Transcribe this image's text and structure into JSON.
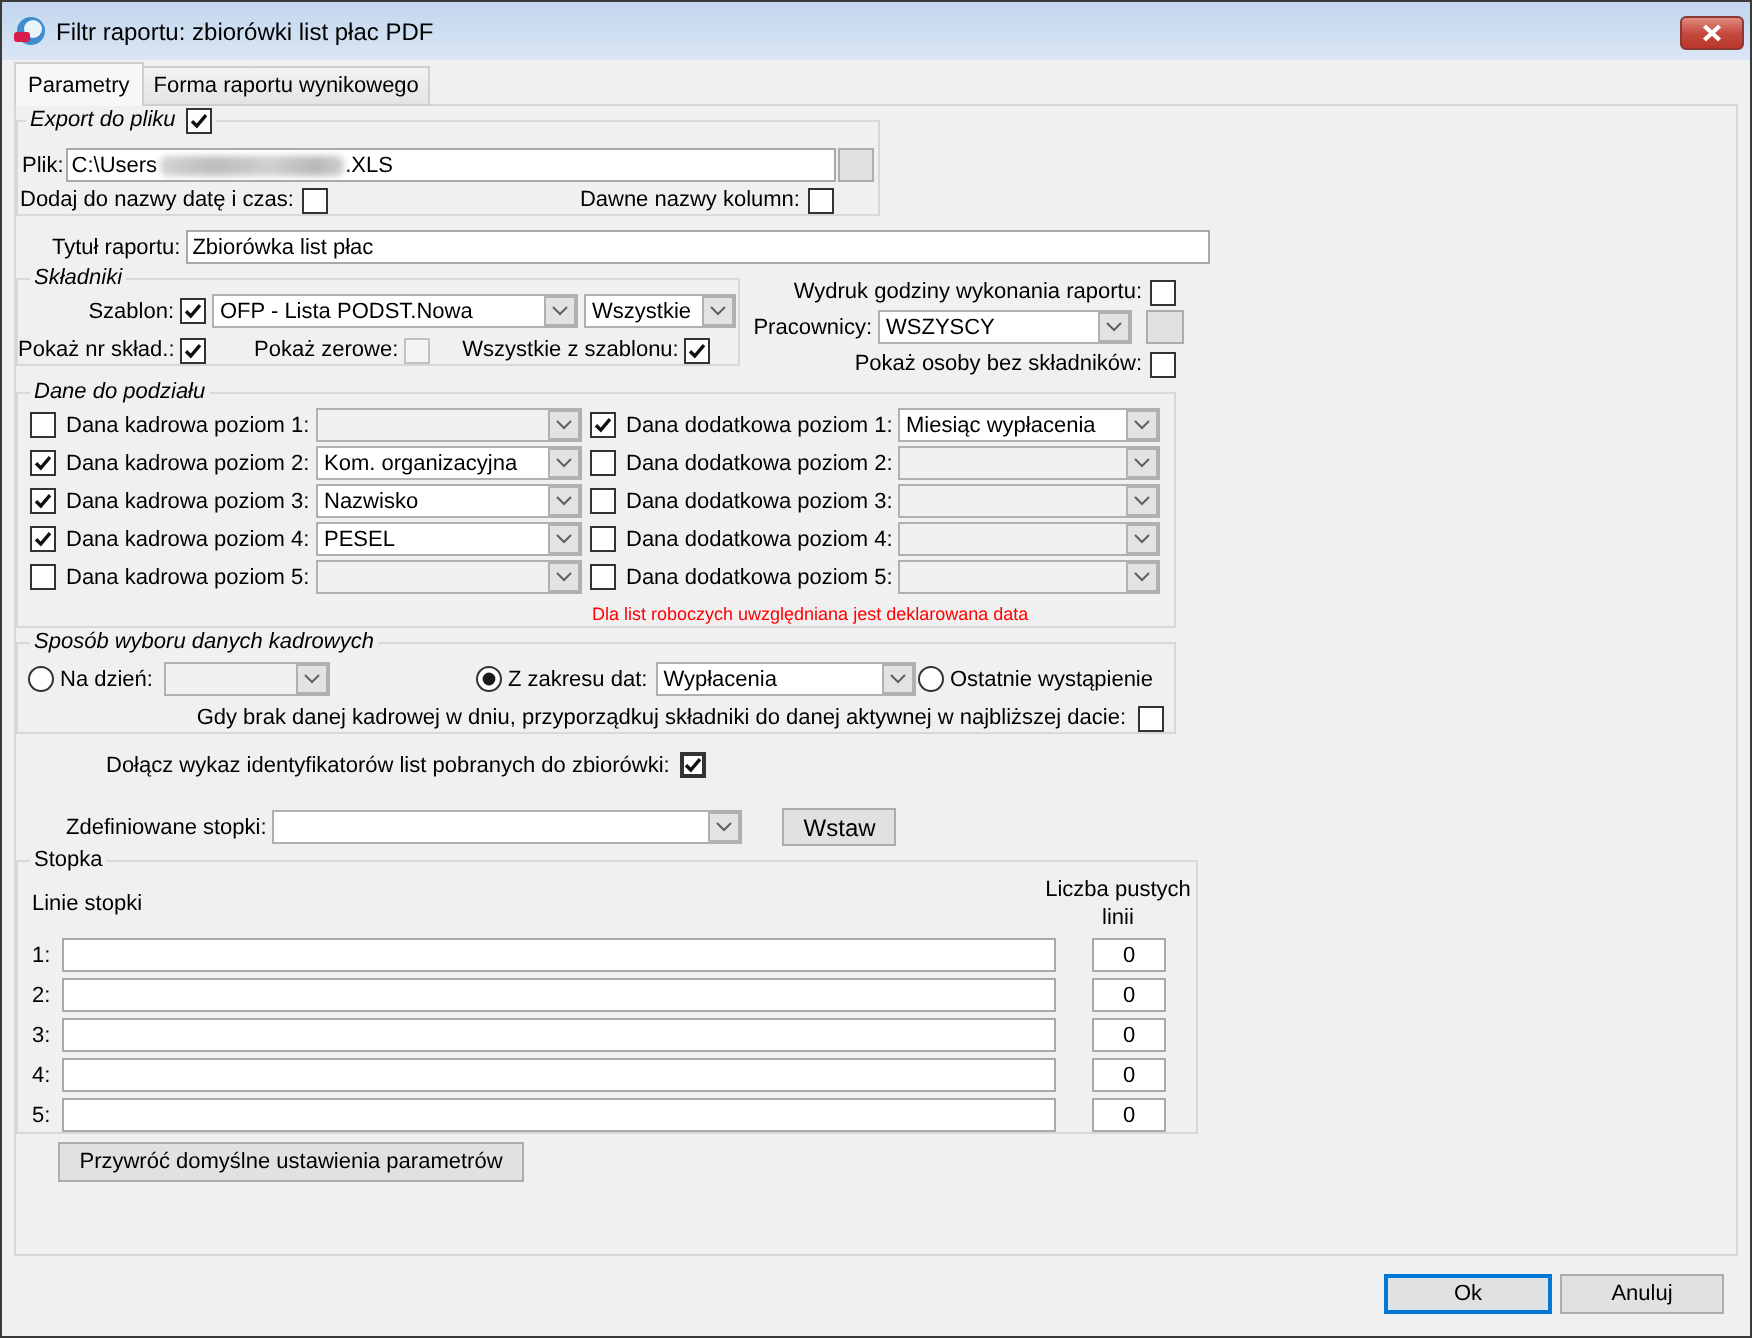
{
  "window": {
    "title": "Filtr raportu: zbiorówki list płac PDF"
  },
  "tabs": [
    {
      "label": "Parametry",
      "selected": true
    },
    {
      "label": "Forma raportu wynikowego",
      "selected": false
    }
  ],
  "export": {
    "legend": "Export do pliku",
    "checked": true,
    "file": {
      "label": "Plik:",
      "value_start": "C:\\Users",
      "value_blurred": true,
      "value_end": ".XLS"
    },
    "add_date_time": {
      "label": "Dodaj do nazwy datę i czas:",
      "checked": false
    },
    "old_column_names": {
      "label": "Dawne nazwy kolumn:",
      "checked": false
    }
  },
  "report_title": {
    "label": "Tytuł raportu:",
    "value": "Zbiorówka list płac"
  },
  "components": {
    "legend": "Składniki",
    "template": {
      "label": "Szablon:",
      "checked": true,
      "value": "OFP - Lista PODST.Nowa",
      "scope": "Wszystkie"
    },
    "show_number": {
      "label": "Pokaż nr skład.:",
      "checked": true
    },
    "show_zero": {
      "label": "Pokaż zerowe:",
      "checked": false,
      "disabled": true
    },
    "all_from_template": {
      "label": "Wszystkie z szablonu:",
      "checked": true
    }
  },
  "print_time": {
    "label": "Wydruk godziny wykonania raportu:",
    "checked": false
  },
  "employees": {
    "label": "Pracownicy:",
    "value": "WSZYSCY"
  },
  "show_without_components": {
    "label": "Pokaż osoby bez składników:",
    "checked": false
  },
  "split_data": {
    "legend": "Dane do podziału",
    "hr_levels": [
      {
        "label": "Dana kadrowa poziom 1:",
        "checked": false
      },
      {
        "label": "Dana kadrowa poziom 2:",
        "checked": true,
        "value": "Kom. organizacyjna"
      },
      {
        "label": "Dana kadrowa poziom 3:",
        "checked": true,
        "value": "Nazwisko"
      },
      {
        "label": "Dana kadrowa poziom 4:",
        "checked": true,
        "value": "PESEL"
      },
      {
        "label": "Dana kadrowa poziom 5:",
        "checked": false
      }
    ],
    "extra_levels": [
      {
        "label": "Dana dodatkowa poziom 1:",
        "checked": true,
        "value": "Miesiąc wypłacenia"
      },
      {
        "label": "Dana dodatkowa poziom 2:",
        "checked": false
      },
      {
        "label": "Dana dodatkowa poziom 3:",
        "checked": false
      },
      {
        "label": "Dana dodatkowa poziom 4:",
        "checked": false
      },
      {
        "label": "Dana dodatkowa poziom 5:",
        "checked": false
      }
    ],
    "note": "Dla list roboczych uwzględniana jest deklarowana data"
  },
  "selection_method": {
    "legend": "Sposób wyboru danych kadrowych",
    "options": [
      {
        "kind": "dropdown",
        "label": "Na dzień:",
        "selected": false
      },
      {
        "kind": "dropdown",
        "label": "Z zakresu dat:",
        "selected": true,
        "value": "Wypłacenia"
      },
      {
        "kind": "plain",
        "label": "Ostatnie wystąpienie",
        "selected": false
      }
    ],
    "nearest_date": {
      "label": "Gdy brak danej kadrowej w dniu, przyporządkuj składniki do danej aktywnej w najbliższej dacie:",
      "checked": false
    }
  },
  "attach_ids": {
    "label": "Dołącz wykaz identyfikatorów list pobranych do zbiorówki:",
    "checked": true,
    "focused": true
  },
  "defined_footers": {
    "label": "Zdefiniowane stopki:",
    "button": "Wstaw"
  },
  "footer_lines": {
    "legend": "Stopka",
    "lines_heading": "Linie stopki",
    "blank_heading": "Liczba pustych linii",
    "rows": [
      {
        "number": "1:",
        "blank_lines": "0"
      },
      {
        "number": "2:",
        "blank_lines": "0"
      },
      {
        "number": "3:",
        "blank_lines": "0"
      },
      {
        "number": "4:",
        "blank_lines": "0"
      },
      {
        "number": "5:",
        "blank_lines": "0"
      }
    ]
  },
  "restore_button": "Przywróć domyślne ustawienia parametrów",
  "buttons": [
    {
      "label": "Ok",
      "default": true
    },
    {
      "label": "Anuluj",
      "default": false
    }
  ]
}
